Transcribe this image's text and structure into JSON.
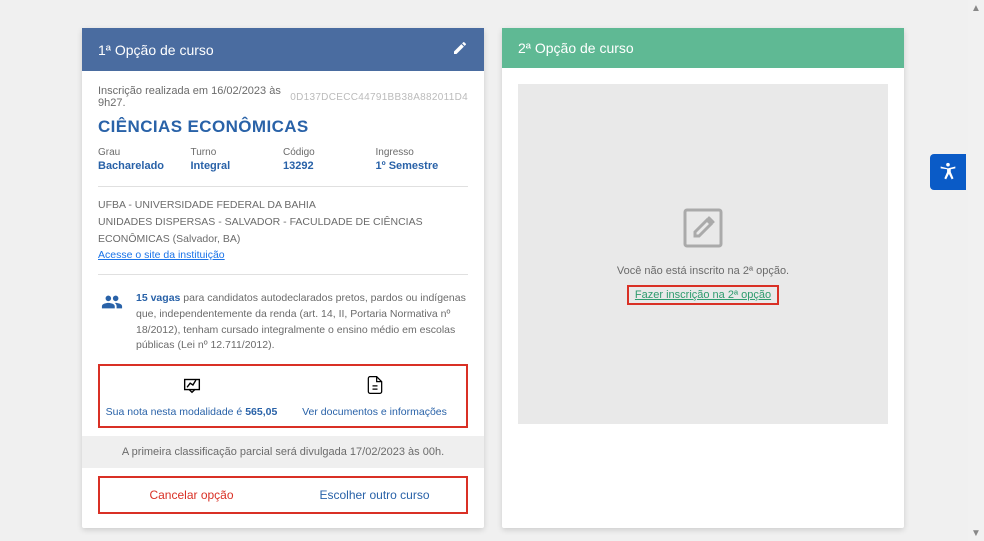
{
  "option1": {
    "headerTitle": "1ª Opção de curso",
    "inscriptionText": "Inscrição realizada em 16/02/2023 às 9h27.",
    "hash": "0D137DCECC44791BB38A882011D4",
    "courseName": "CIÊNCIAS ECONÔMICAS",
    "details": {
      "grauLabel": "Grau",
      "grauValue": "Bacharelado",
      "turnoLabel": "Turno",
      "turnoValue": "Integral",
      "codigoLabel": "Código",
      "codigoValue": "13292",
      "ingressoLabel": "Ingresso",
      "ingressoValue": "1º Semestre"
    },
    "institution": {
      "line1": "UFBA - UNIVERSIDADE FEDERAL DA BAHIA",
      "line2": "UNIDADES DISPERSAS - SALVADOR - FACULDADE DE CIÊNCIAS ECONÔMICAS (Salvador, BA)",
      "siteLink": "Acesse o site da instituição"
    },
    "quota": {
      "vagasCount": "15 vagas",
      "text": " para candidatos autodeclarados pretos, pardos ou indígenas que, independentemente da renda (art. 14, II, Portaria Normativa nº 18/2012), tenham cursado integralmente o ensino médio em escolas públicas (Lei nº 12.711/2012)."
    },
    "scorePrefix": "Sua nota nesta modalidade é ",
    "scoreValue": "565,05",
    "docsLink": "Ver documentos e informações",
    "notice": "A primeira classificação parcial será divulgada 17/02/2023 às 00h.",
    "cancelLabel": "Cancelar opção",
    "changeLabel": "Escolher outro curso"
  },
  "option2": {
    "headerTitle": "2ª Opção de curso",
    "emptyText": "Você não está inscrito na 2ª opção.",
    "emptyLink": "Fazer inscrição na 2ª opção"
  }
}
